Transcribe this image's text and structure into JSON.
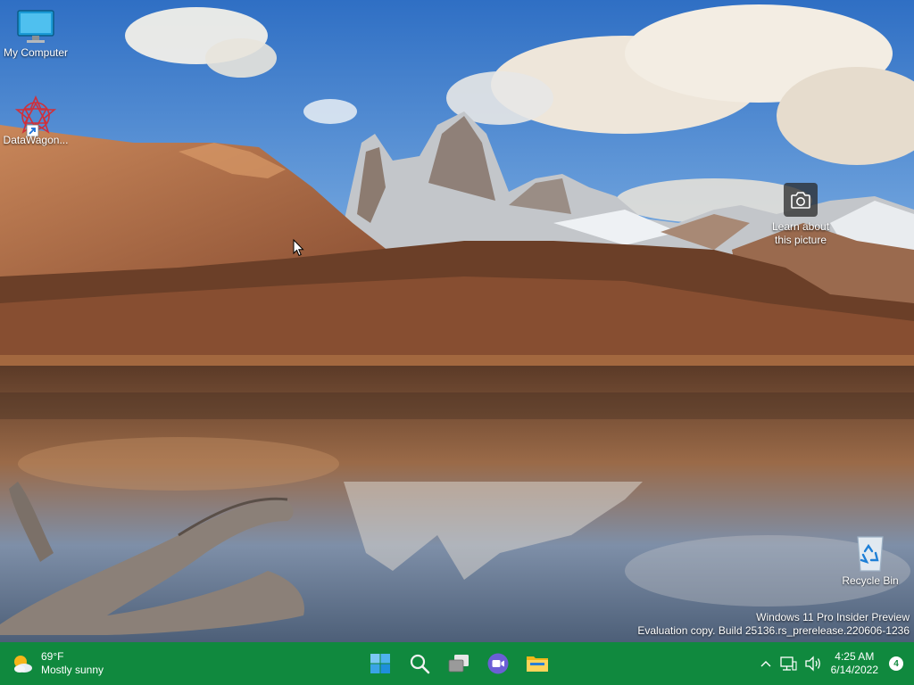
{
  "desktop": {
    "icons": [
      {
        "label": "My Computer",
        "icon": "monitor-icon"
      },
      {
        "label": "DataWagon...",
        "icon": "datawagon-app-icon"
      },
      {
        "label": "Recycle Bin",
        "icon": "recycle-bin-icon"
      }
    ],
    "learn_about": {
      "line1": "Learn about",
      "line2": "this picture",
      "icon": "camera-icon"
    },
    "watermark": {
      "line1": "Windows 11 Pro Insider Preview",
      "line2": "Evaluation copy. Build 25136.rs_prerelease.220606-1236"
    }
  },
  "taskbar": {
    "color": "#10893e",
    "weather": {
      "temp": "69°F",
      "condition": "Mostly sunny",
      "icon": "sun-cloud-icon"
    },
    "apps": [
      {
        "name": "Start",
        "icon": "windows-start-icon"
      },
      {
        "name": "Search",
        "icon": "search-icon"
      },
      {
        "name": "Task View",
        "icon": "task-view-icon"
      },
      {
        "name": "Chat",
        "icon": "video-chat-icon"
      },
      {
        "name": "File Explorer",
        "icon": "folder-icon"
      }
    ],
    "tray": {
      "time": "4:25 AM",
      "date": "6/14/2022",
      "notification_count": "4"
    }
  }
}
